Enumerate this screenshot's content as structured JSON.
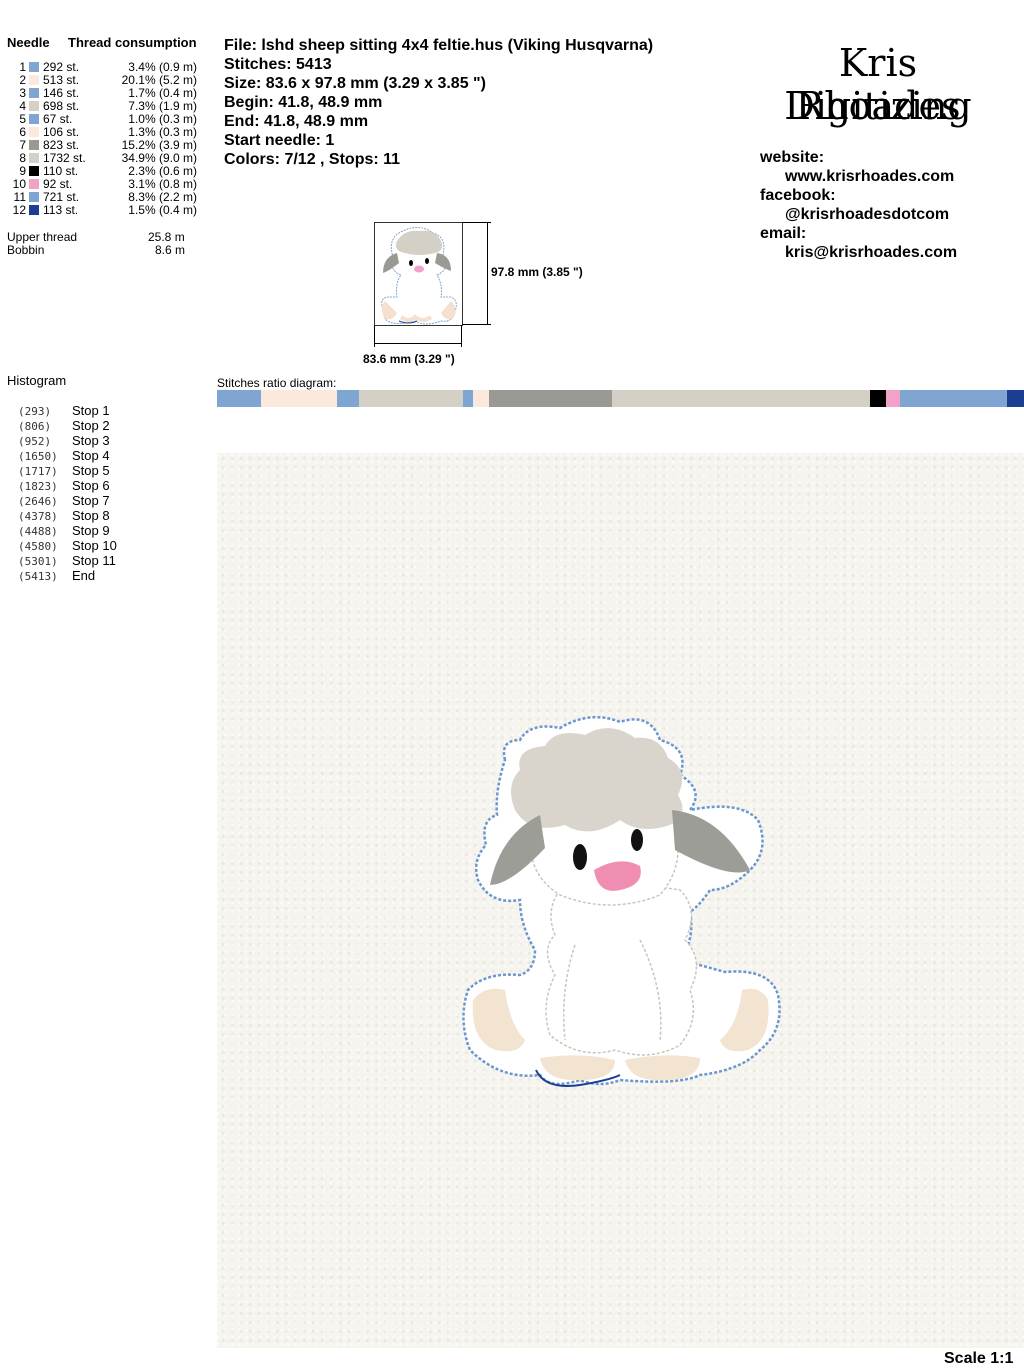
{
  "needle_table": {
    "header_needle": "Needle",
    "header_thread": "Thread consumption",
    "rows": [
      {
        "num": "1",
        "color": "#7fa6d2",
        "stitches": "292 st.",
        "pct": "3.4% (0.9 m)"
      },
      {
        "num": "2",
        "color": "#fce9dd",
        "stitches": "513 st.",
        "pct": "20.1% (5.2 m)"
      },
      {
        "num": "3",
        "color": "#7fa6d2",
        "stitches": "146 st.",
        "pct": "1.7% (0.4 m)"
      },
      {
        "num": "4",
        "color": "#d4d0c6",
        "stitches": "698 st.",
        "pct": "7.3% (1.9 m)"
      },
      {
        "num": "5",
        "color": "#7fa6d2",
        "stitches": "67 st.",
        "pct": "1.0% (0.3 m)"
      },
      {
        "num": "6",
        "color": "#fce9dd",
        "stitches": "106 st.",
        "pct": "1.3% (0.3 m)"
      },
      {
        "num": "7",
        "color": "#9a9a94",
        "stitches": "823 st.",
        "pct": "15.2% (3.9 m)"
      },
      {
        "num": "8",
        "color": "#d4d0c6",
        "stitches": "1732 st.",
        "pct": "34.9% (9.0 m)"
      },
      {
        "num": "9",
        "color": "#000000",
        "stitches": "110 st.",
        "pct": "2.3% (0.6 m)"
      },
      {
        "num": "10",
        "color": "#f2a2c6",
        "stitches": "92 st.",
        "pct": "3.1% (0.8 m)"
      },
      {
        "num": "11",
        "color": "#7fa6d2",
        "stitches": "721 st.",
        "pct": "8.3% (2.2 m)"
      },
      {
        "num": "12",
        "color": "#1b3e93",
        "stitches": "113 st.",
        "pct": "1.5% (0.4 m)"
      }
    ],
    "upper_thread_label": "Upper thread",
    "upper_thread_value": "25.8 m",
    "bobbin_label": "Bobbin",
    "bobbin_value": "8.6 m"
  },
  "file_info": {
    "file": "File: lshd sheep sitting 4x4 feltie.hus  (Viking Husqvarna)",
    "stitches": "Stitches: 5413",
    "size": "Size: 83.6 x 97.8 mm (3.29 x 3.85 \")",
    "begin": "Begin: 41.8, 48.9 mm",
    "end": "End: 41.8, 48.9 mm",
    "start_needle": "Start needle: 1",
    "colors": "Colors: 7/12 , Stops: 11"
  },
  "preview": {
    "height_label": "97.8 mm (3.85 \")",
    "width_label": "83.6 mm (3.29 \")"
  },
  "brand": {
    "line1": "Kris Rhoades",
    "line2": "Digitizing",
    "website_label": "website:",
    "website": "www.krisrhoades.com",
    "facebook_label": "facebook:",
    "facebook": "@krisrhoadesdotcom",
    "email_label": "email:",
    "email": "kris@krisrhoades.com"
  },
  "histogram": {
    "title": "Histogram",
    "rows": [
      {
        "count": "(293)",
        "label": "Stop 1"
      },
      {
        "count": "(806)",
        "label": "Stop 2"
      },
      {
        "count": "(952)",
        "label": "Stop 3"
      },
      {
        "count": "(1650)",
        "label": "Stop 4"
      },
      {
        "count": "(1717)",
        "label": "Stop 5"
      },
      {
        "count": "(1823)",
        "label": "Stop 6"
      },
      {
        "count": "(2646)",
        "label": "Stop 7"
      },
      {
        "count": "(4378)",
        "label": "Stop 8"
      },
      {
        "count": "(4488)",
        "label": "Stop 9"
      },
      {
        "count": "(4580)",
        "label": "Stop 10"
      },
      {
        "count": "(5301)",
        "label": "Stop 11"
      },
      {
        "count": "(5413)",
        "label": "End"
      }
    ]
  },
  "ratio": {
    "title": "Stitches ratio diagram:",
    "segments": [
      {
        "color": "#7fa6d2",
        "fraction": 0.054
      },
      {
        "color": "#fce9dd",
        "fraction": 0.095
      },
      {
        "color": "#7fa6d2",
        "fraction": 0.027
      },
      {
        "color": "#d4d0c6",
        "fraction": 0.129
      },
      {
        "color": "#7fa6d2",
        "fraction": 0.012
      },
      {
        "color": "#fce9dd",
        "fraction": 0.02
      },
      {
        "color": "#9a9a94",
        "fraction": 0.152
      },
      {
        "color": "#d4d0c6",
        "fraction": 0.32
      },
      {
        "color": "#000000",
        "fraction": 0.02
      },
      {
        "color": "#f2a2c6",
        "fraction": 0.017
      },
      {
        "color": "#7fa6d2",
        "fraction": 0.133
      },
      {
        "color": "#1b3e93",
        "fraction": 0.021
      }
    ]
  },
  "scale": "Scale 1:1"
}
